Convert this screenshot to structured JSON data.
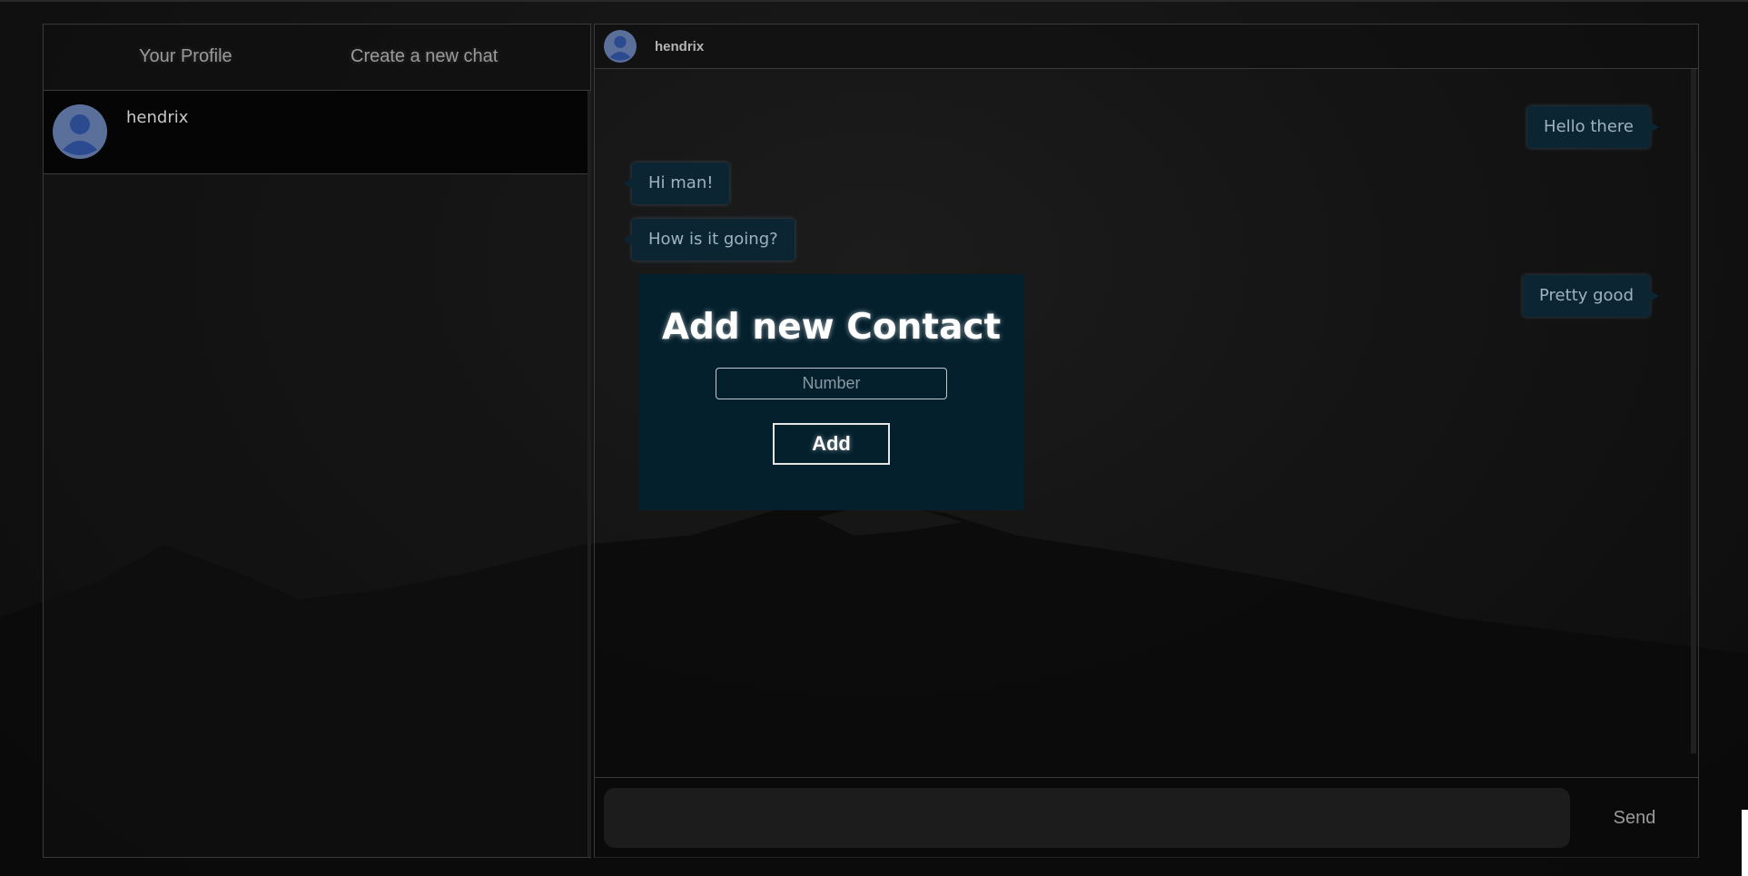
{
  "left_panel": {
    "nav": {
      "profile_label": "Your Profile",
      "create_chat_label": "Create a new chat"
    },
    "contacts": [
      {
        "name": "hendrix"
      }
    ]
  },
  "chat": {
    "header": {
      "name": "hendrix"
    },
    "messages": [
      {
        "text": "Hello there",
        "direction": "outgoing"
      },
      {
        "text": "Hi man!",
        "direction": "incoming"
      },
      {
        "text": "How is it going?",
        "direction": "incoming"
      },
      {
        "text": "Pretty good",
        "direction": "outgoing"
      }
    ],
    "composer": {
      "value": "",
      "send_label": "Send"
    }
  },
  "modal": {
    "title": "Add new Contact",
    "input_placeholder": "Number",
    "add_label": "Add"
  },
  "colors": {
    "bubble_bg": "#0c2533",
    "modal_bg": "#04202d",
    "avatar": "#5a6f9a",
    "avatar_figure": "#2b4a8f"
  }
}
